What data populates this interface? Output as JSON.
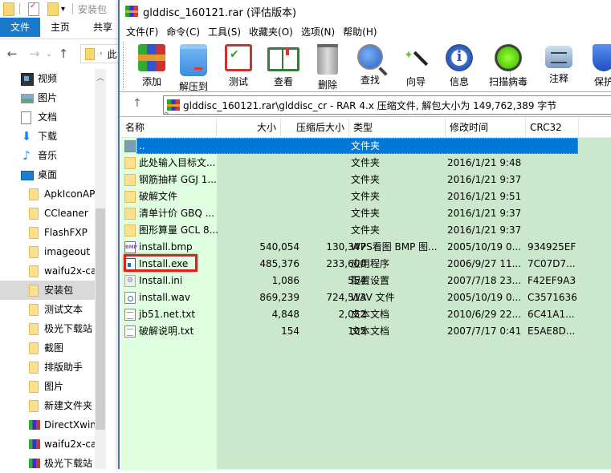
{
  "explorer": {
    "title": "安装包",
    "ribbon_tabs": [
      "文件",
      "主页",
      "共享"
    ],
    "address_partial": "此",
    "tree": [
      {
        "label": "视频",
        "icon": "video-icon",
        "level": 0
      },
      {
        "label": "图片",
        "icon": "pictures-icon",
        "level": 0
      },
      {
        "label": "文档",
        "icon": "documents-icon",
        "level": 0
      },
      {
        "label": "下载",
        "icon": "download-icon",
        "level": 0
      },
      {
        "label": "音乐",
        "icon": "music-icon",
        "level": 0
      },
      {
        "label": "桌面",
        "icon": "desktop-icon",
        "level": 0
      },
      {
        "label": "ApkIconAP",
        "icon": "folder-icon",
        "level": 1
      },
      {
        "label": "CCleaner",
        "icon": "folder-icon",
        "level": 1
      },
      {
        "label": "FlashFXP",
        "icon": "folder-icon",
        "level": 1
      },
      {
        "label": "imageout",
        "icon": "folder-icon",
        "level": 1
      },
      {
        "label": "waifu2x-ca",
        "icon": "folder-icon",
        "level": 1
      },
      {
        "label": "安装包",
        "icon": "folder-icon",
        "level": 1,
        "selected": true
      },
      {
        "label": "测试文本",
        "icon": "folder-icon",
        "level": 1
      },
      {
        "label": "极光下载站",
        "icon": "folder-icon",
        "level": 1
      },
      {
        "label": "截图",
        "icon": "folder-icon",
        "level": 1
      },
      {
        "label": "排版助手",
        "icon": "folder-icon",
        "level": 1
      },
      {
        "label": "图片",
        "icon": "folder-icon",
        "level": 1
      },
      {
        "label": "新建文件夹",
        "icon": "folder-icon",
        "level": 1
      },
      {
        "label": "DirectXwin",
        "icon": "rar-archive-icon",
        "level": 1
      },
      {
        "label": "waifu2x-ca",
        "icon": "rar-archive-icon",
        "level": 1
      },
      {
        "label": "极光下载站",
        "icon": "rar-archive-icon",
        "level": 1
      }
    ]
  },
  "winrar": {
    "title": "glddisc_160121.rar (评估版本)",
    "menu": [
      "文件(F)",
      "命令(C)",
      "工具(S)",
      "收藏夹(O)",
      "选项(N)",
      "帮助(H)"
    ],
    "toolbar": [
      {
        "label": "添加",
        "icon": "add-archive-icon",
        "name": "add"
      },
      {
        "label": "解压到",
        "icon": "extract-to-icon",
        "name": "extract-to"
      },
      {
        "label": "测试",
        "icon": "test-icon",
        "name": "test"
      },
      {
        "label": "查看",
        "icon": "view-icon",
        "name": "view"
      },
      {
        "label": "删除",
        "icon": "delete-icon",
        "name": "delete"
      },
      {
        "label": "查找",
        "icon": "find-icon",
        "name": "find"
      },
      {
        "label": "向导",
        "icon": "wizard-icon",
        "name": "wizard"
      },
      {
        "label": "信息",
        "icon": "info-icon",
        "name": "info"
      },
      {
        "label": "扫描病毒",
        "icon": "virus-scan-icon",
        "name": "virus-scan"
      },
      {
        "label": "注释",
        "icon": "comment-icon",
        "name": "comment"
      },
      {
        "label": "保护",
        "icon": "protect-icon",
        "name": "protect"
      }
    ],
    "address": "glddisc_160121.rar\\glddisc_cr - RAR 4.x 压缩文件, 解包大小为 149,762,389 字节",
    "columns": [
      "名称",
      "大小",
      "压缩后大小",
      "类型",
      "修改时间",
      "CRC32"
    ],
    "rows": [
      {
        "name": "..",
        "size": "",
        "packed": "",
        "type": "文件夹",
        "modified": "",
        "crc": "",
        "icon": "parent-folder-icon",
        "selected": true
      },
      {
        "name": "此处输入目标文...",
        "size": "",
        "packed": "",
        "type": "文件夹",
        "modified": "2016/1/21 9:48",
        "crc": "",
        "icon": "folder-icon"
      },
      {
        "name": "钢筋抽样 GGJ 1...",
        "size": "",
        "packed": "",
        "type": "文件夹",
        "modified": "2016/1/21 9:37",
        "crc": "",
        "icon": "folder-icon"
      },
      {
        "name": "破解文件",
        "size": "",
        "packed": "",
        "type": "文件夹",
        "modified": "2016/1/21 9:51",
        "crc": "",
        "icon": "folder-icon"
      },
      {
        "name": "清单计价 GBQ ...",
        "size": "",
        "packed": "",
        "type": "文件夹",
        "modified": "2016/1/21 9:37",
        "crc": "",
        "icon": "folder-icon"
      },
      {
        "name": "图形算量 GCL 8...",
        "size": "",
        "packed": "",
        "type": "文件夹",
        "modified": "2016/1/21 9:37",
        "crc": "",
        "icon": "folder-icon"
      },
      {
        "name": "install.bmp",
        "size": "540,054",
        "packed": "130,347",
        "type": "WPS看图 BMP 图...",
        "modified": "2005/10/19 0...",
        "crc": "934925EF",
        "icon": "bmp-file-icon"
      },
      {
        "name": "Install.exe",
        "size": "485,376",
        "packed": "233,600",
        "type": "应用程序",
        "modified": "2006/9/27 11...",
        "crc": "7C07D7...",
        "icon": "exe-file-icon",
        "highlighted": true
      },
      {
        "name": "Install.ini",
        "size": "1,086",
        "packed": "554",
        "type": "配置设置",
        "modified": "2007/7/18 23...",
        "crc": "F42EF9A3",
        "icon": "ini-file-icon"
      },
      {
        "name": "install.wav",
        "size": "869,239",
        "packed": "724,513",
        "type": "WAV 文件",
        "modified": "2005/10/19 0...",
        "crc": "C3571636",
        "icon": "wav-file-icon"
      },
      {
        "name": "jb51.net.txt",
        "size": "4,848",
        "packed": "2,052",
        "type": "文本文档",
        "modified": "2010/6/29 22...",
        "crc": "6C41A1...",
        "icon": "txt-file-icon"
      },
      {
        "name": "破解说明.txt",
        "size": "154",
        "packed": "105",
        "type": "文本文档",
        "modified": "2007/7/17 0:41",
        "crc": "E5AE8D...",
        "icon": "txt-file-icon"
      }
    ]
  },
  "colors": {
    "selection": "#0078d7",
    "name_column_bg": "#e0ffe0",
    "list_bg": "#cce8cc",
    "highlight_border": "#e02020",
    "explorer_file_tab": "#1979ca"
  }
}
